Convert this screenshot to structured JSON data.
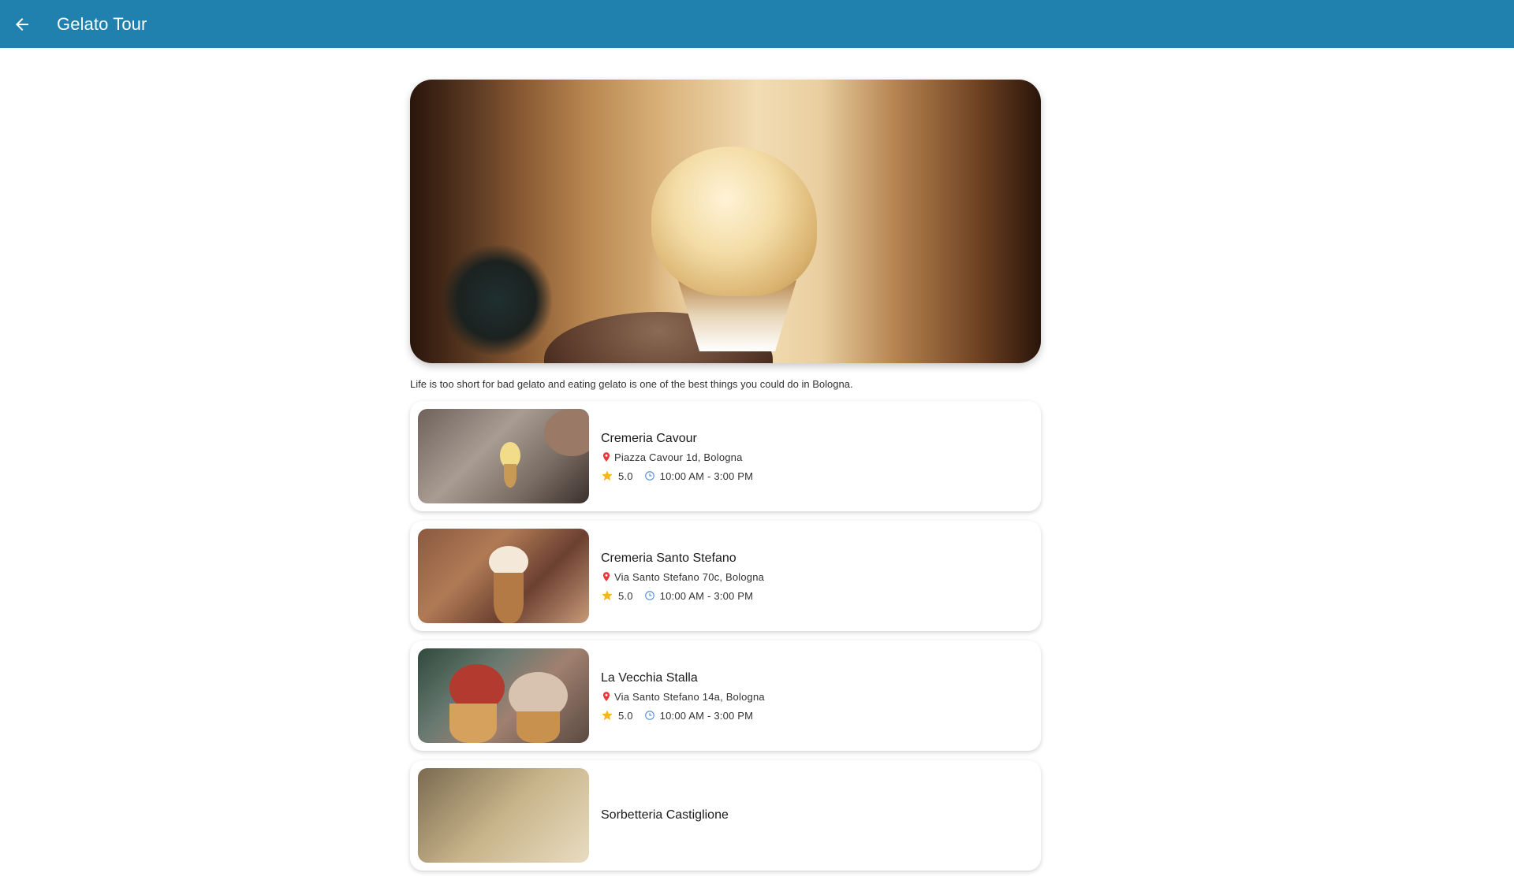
{
  "app_bar": {
    "title": "Gelato Tour",
    "back_icon": "arrow-back-icon",
    "background_color": "#2081ae"
  },
  "intro_text": "Life is too short for bad gelato and eating gelato is one of the best things you could do in Bologna.",
  "places": [
    {
      "name": "Cremeria Cavour",
      "address": "Piazza Cavour 1d, Bologna",
      "rating": "5.0",
      "hours": "10:00 AM - 3:00 PM"
    },
    {
      "name": "Cremeria Santo Stefano",
      "address": "Via Santo Stefano 70c, Bologna",
      "rating": "5.0",
      "hours": "10:00 AM - 3:00 PM"
    },
    {
      "name": "La Vecchia Stalla",
      "address": "Via Santo Stefano 14a, Bologna",
      "rating": "5.0",
      "hours": "10:00 AM - 3:00 PM"
    },
    {
      "name": "Sorbetteria Castiglione",
      "address": "",
      "rating": "",
      "hours": ""
    }
  ],
  "colors": {
    "pin": "#e53935",
    "star": "#f9b61a",
    "clock": "#5a93d6"
  }
}
